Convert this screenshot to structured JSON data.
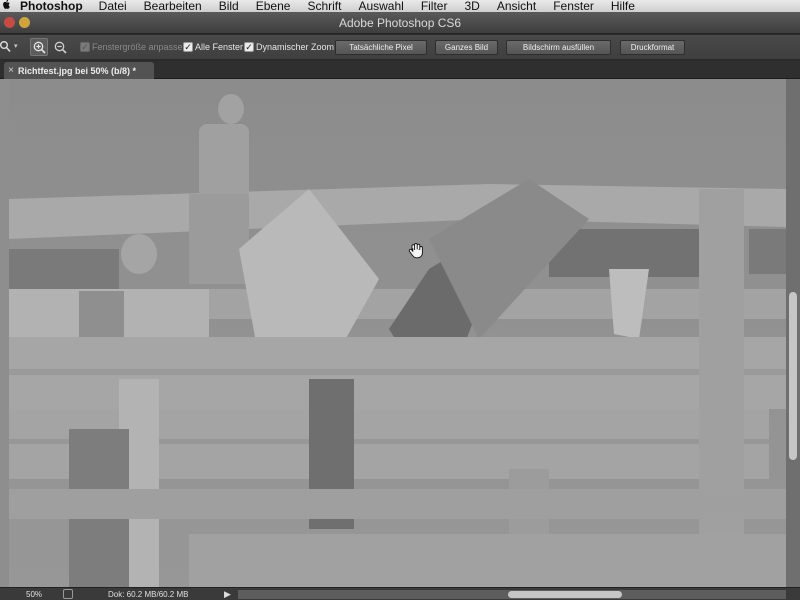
{
  "menubar": {
    "apple": "",
    "app_name": "Photoshop",
    "items": [
      "Datei",
      "Bearbeiten",
      "Bild",
      "Ebene",
      "Schrift",
      "Auswahl",
      "Filter",
      "3D",
      "Ansicht",
      "Fenster",
      "Hilfe"
    ]
  },
  "window": {
    "title": "Adobe Photoshop CS6"
  },
  "options": {
    "checkboxes": [
      {
        "label": "Fenstergröße anpassen",
        "checked": true,
        "enabled": false
      },
      {
        "label": "Alle Fenster",
        "checked": true,
        "enabled": true
      },
      {
        "label": "Dynamischer Zoom",
        "checked": true,
        "enabled": true
      }
    ],
    "buttons": [
      "Tatsächliche Pixel",
      "Ganzes Bild",
      "Bildschirm ausfüllen",
      "Druckformat"
    ]
  },
  "document": {
    "tab_title": "Richtfest.jpg bei 50% (b/8) *"
  },
  "status": {
    "zoom": "50%",
    "doc_info": "Dok: 60.2 MB/60.2 MB"
  },
  "icons": {
    "tool": "zoom-tool-icon",
    "zoom_in": "zoom-in-icon",
    "zoom_out": "zoom-out-icon",
    "cursor": "hand-cursor-icon"
  }
}
